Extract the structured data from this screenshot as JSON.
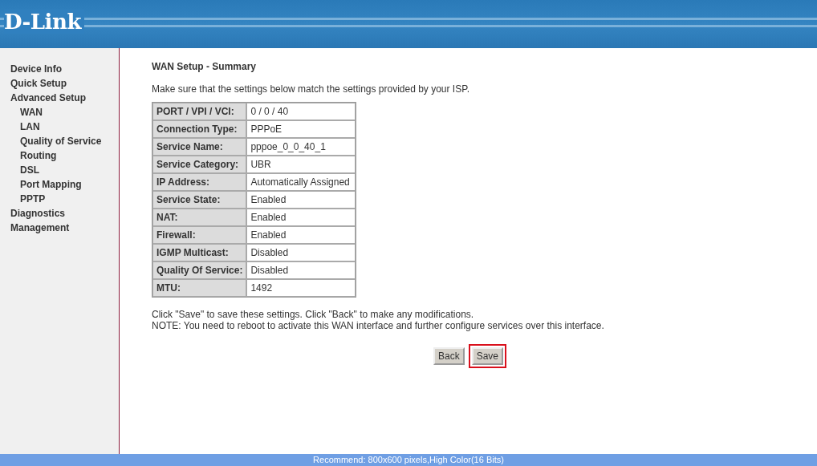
{
  "header": {
    "logo": "D-Link"
  },
  "sidebar": {
    "items": [
      {
        "label": "Device Info"
      },
      {
        "label": "Quick Setup"
      },
      {
        "label": "Advanced Setup",
        "children": [
          {
            "label": "WAN"
          },
          {
            "label": "LAN"
          },
          {
            "label": "Quality of Service"
          },
          {
            "label": "Routing"
          },
          {
            "label": "DSL"
          },
          {
            "label": "Port Mapping"
          },
          {
            "label": "PPTP"
          }
        ]
      },
      {
        "label": "Diagnostics"
      },
      {
        "label": "Management"
      }
    ]
  },
  "page": {
    "title": "WAN Setup - Summary",
    "intro": "Make sure that the settings below match the settings provided by your ISP.",
    "table": {
      "rows": [
        {
          "label": "PORT / VPI / VCI:",
          "value": "0 / 0 / 40"
        },
        {
          "label": "Connection Type:",
          "value": "PPPoE"
        },
        {
          "label": "Service Name:",
          "value": "pppoe_0_0_40_1"
        },
        {
          "label": "Service Category:",
          "value": "UBR"
        },
        {
          "label": "IP Address:",
          "value": "Automatically Assigned"
        },
        {
          "label": "Service State:",
          "value": "Enabled"
        },
        {
          "label": "NAT:",
          "value": "Enabled"
        },
        {
          "label": "Firewall:",
          "value": "Enabled"
        },
        {
          "label": "IGMP Multicast:",
          "value": "Disabled"
        },
        {
          "label": "Quality Of Service:",
          "value": "Disabled"
        },
        {
          "label": "MTU:",
          "value": "1492"
        }
      ]
    },
    "notes": [
      "Click \"Save\" to save these settings. Click \"Back\" to make any modifications.",
      "NOTE: You need to reboot to activate this WAN interface and further configure services over this interface."
    ],
    "buttons": [
      {
        "label": "Back",
        "highlighted": false
      },
      {
        "label": "Save",
        "highlighted": true
      }
    ]
  },
  "footer": {
    "text": "Recommend: 800x600 pixels,High Color(16 Bits)"
  }
}
